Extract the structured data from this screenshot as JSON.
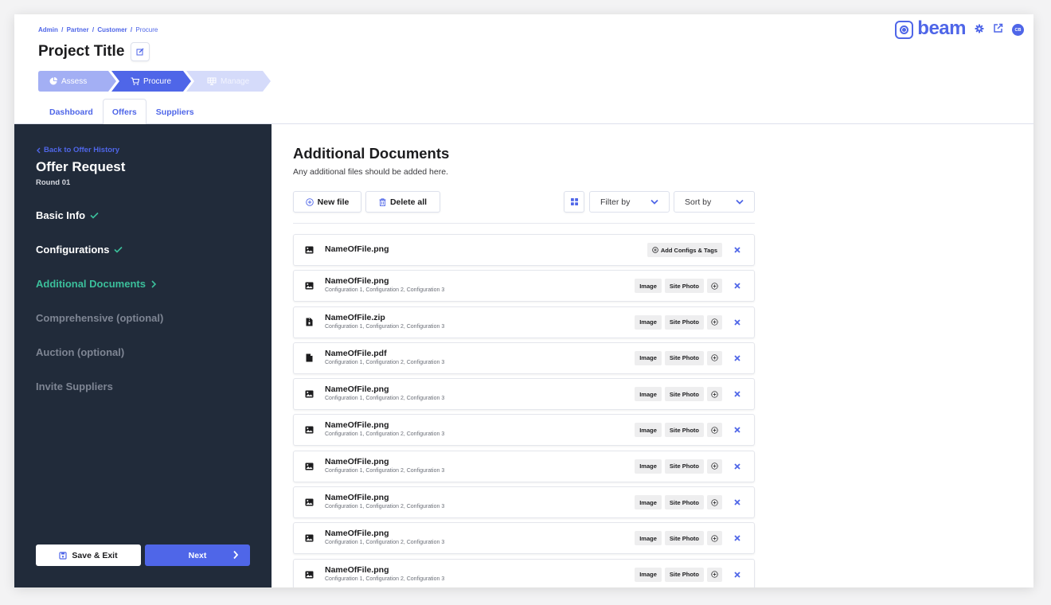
{
  "header": {
    "breadcrumb": [
      "Admin",
      "Partner",
      "Customer",
      "Procure"
    ],
    "breadcrumb_separator": "/",
    "title": "Project Title",
    "stepper": [
      {
        "label": "Assess",
        "icon": "pie-chart-icon",
        "state": "complete"
      },
      {
        "label": "Procure",
        "icon": "cart-icon",
        "state": "active"
      },
      {
        "label": "Manage",
        "icon": "solar-panel-icon",
        "state": "upcoming"
      }
    ],
    "tabs": [
      {
        "label": "Dashboard",
        "active": false
      },
      {
        "label": "Offers",
        "active": true
      },
      {
        "label": "Suppliers",
        "active": false
      }
    ],
    "brand": {
      "name": "beam",
      "avatar_initials": "CB"
    }
  },
  "sidebar": {
    "back_link": "Back to Offer History",
    "title": "Offer Request",
    "subtitle": "Round 01",
    "nav": [
      {
        "label": "Basic Info",
        "state": "done"
      },
      {
        "label": "Configurations",
        "state": "done"
      },
      {
        "label": "Additional Documents",
        "state": "active"
      },
      {
        "label": "Comprehensive (optional)",
        "state": "disabled"
      },
      {
        "label": "Auction (optional)",
        "state": "disabled"
      },
      {
        "label": "Invite Suppliers",
        "state": "disabled"
      }
    ],
    "save_exit_label": "Save & Exit",
    "next_label": "Next"
  },
  "main": {
    "title": "Additional Documents",
    "subtitle": "Any additional files should be added here.",
    "toolbar": {
      "new_file_label": "New file",
      "delete_all_label": "Delete all",
      "filter_label": "Filter by",
      "sort_label": "Sort by"
    },
    "add_configs_label": "Add Configs & Tags",
    "files": [
      {
        "name": "NameOfFile.png",
        "type": "image",
        "configs": "",
        "tags": []
      },
      {
        "name": "NameOfFile.png",
        "type": "image",
        "configs": "Configuration 1, Configuration 2, Configuration 3",
        "tags": [
          "Image",
          "Site Photo"
        ]
      },
      {
        "name": "NameOfFile.zip",
        "type": "zip",
        "configs": "Configuration 1, Configuration 2, Configuration 3",
        "tags": [
          "Image",
          "Site Photo"
        ]
      },
      {
        "name": "NameOfFile.pdf",
        "type": "pdf",
        "configs": "Configuration 1, Configuration 2, Configuration 3",
        "tags": [
          "Image",
          "Site Photo"
        ]
      },
      {
        "name": "NameOfFile.png",
        "type": "image",
        "configs": "Configuration 1, Configuration 2, Configuration 3",
        "tags": [
          "Image",
          "Site Photo"
        ]
      },
      {
        "name": "NameOfFile.png",
        "type": "image",
        "configs": "Configuration 1, Configuration 2, Configuration 3",
        "tags": [
          "Image",
          "Site Photo"
        ]
      },
      {
        "name": "NameOfFile.png",
        "type": "image",
        "configs": "Configuration 1, Configuration 2, Configuration 3",
        "tags": [
          "Image",
          "Site Photo"
        ]
      },
      {
        "name": "NameOfFile.png",
        "type": "image",
        "configs": "Configuration 1, Configuration 2, Configuration 3",
        "tags": [
          "Image",
          "Site Photo"
        ]
      },
      {
        "name": "NameOfFile.png",
        "type": "image",
        "configs": "Configuration 1, Configuration 2, Configuration 3",
        "tags": [
          "Image",
          "Site Photo"
        ]
      },
      {
        "name": "NameOfFile.png",
        "type": "image",
        "configs": "Configuration 1, Configuration 2, Configuration 3",
        "tags": [
          "Image",
          "Site Photo"
        ]
      }
    ]
  },
  "colors": {
    "accent": "#4f66e8",
    "success": "#3bbf9b",
    "sidebar_bg": "#212b3a",
    "step_complete": "#a3aff4",
    "step_upcoming": "#d5dbfa"
  }
}
